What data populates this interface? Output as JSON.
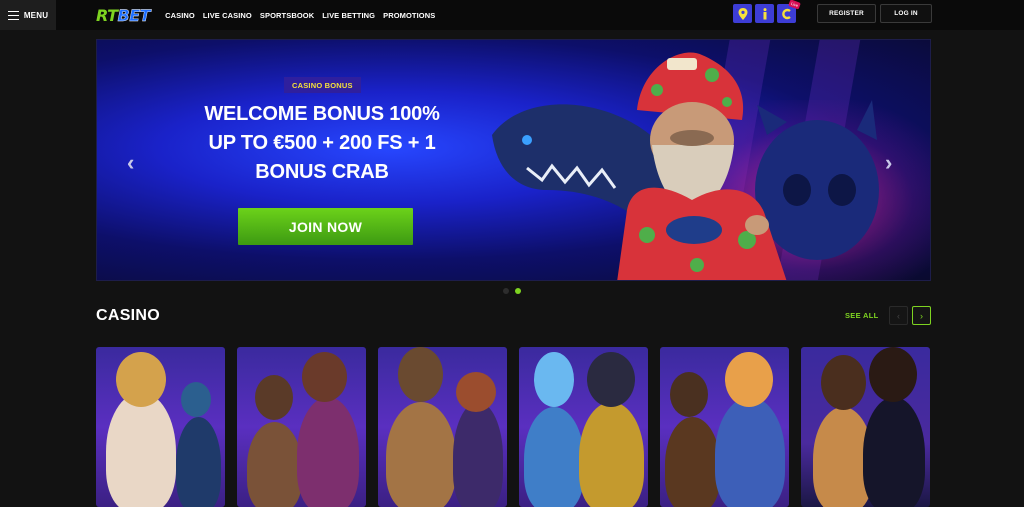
{
  "header": {
    "menu_label": "MENU",
    "logo_rt": "RT",
    "logo_bet": "BET",
    "nav": [
      "CASINO",
      "LIVE CASINO",
      "SPORTSBOOK",
      "LIVE BETTING",
      "PROMOTIONS"
    ],
    "icons": [
      "map-pin-icon",
      "info-icon",
      "chat-icon"
    ],
    "live_badge": "Live",
    "register_label": "REGISTER",
    "login_label": "LOG IN"
  },
  "hero": {
    "tag": "CASINO BONUS",
    "title_line1": "WELCOME BONUS 100%",
    "title_line2": "UP TO €500 + 200 FS + 1",
    "title_line3": "BONUS CRAB",
    "cta": "JOIN NOW",
    "slides_total": 2,
    "slide_active": 2
  },
  "casino": {
    "title": "CASINO",
    "see_all": "SEE ALL",
    "games": 6
  },
  "colors": {
    "accent_green": "#7ed321",
    "brand_blue": "#1e6fff",
    "tag_yellow": "#f6e13b",
    "background": "#121212"
  }
}
